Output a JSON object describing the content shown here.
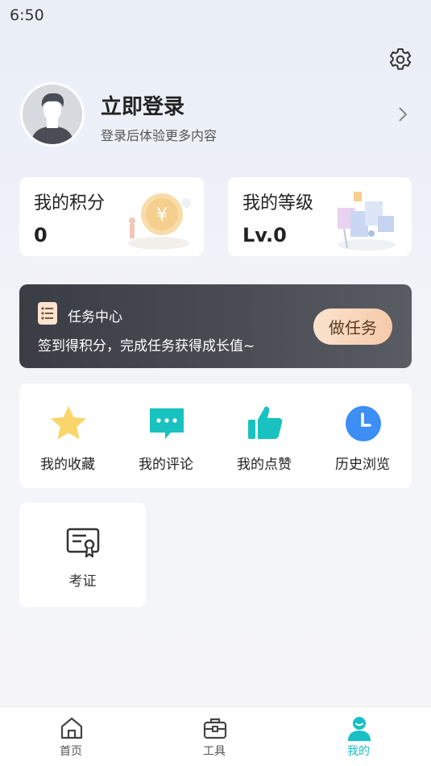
{
  "status_bar": {
    "time": "6:50"
  },
  "profile": {
    "login_title": "立即登录",
    "login_subtitle": "登录后体验更多内容"
  },
  "stats": {
    "points_label": "我的积分",
    "points_value": "0",
    "level_label": "我的等级",
    "level_value": "Lv.0"
  },
  "task_center": {
    "title": "任务中心",
    "description": "签到得积分，完成任务获得成长值~",
    "button_label": "做任务"
  },
  "quick_actions": [
    {
      "label": "我的收藏",
      "icon": "star-icon",
      "color": "#f9d56b"
    },
    {
      "label": "我的评论",
      "icon": "comment-icon",
      "color": "#19c2bf"
    },
    {
      "label": "我的点赞",
      "icon": "thumbs-up-icon",
      "color": "#19c2bf"
    },
    {
      "label": "历史浏览",
      "icon": "clock-icon",
      "color": "#3d8ef5"
    }
  ],
  "tools": [
    {
      "label": "考证",
      "icon": "certificate-icon"
    }
  ],
  "bottom_nav": [
    {
      "label": "首页",
      "icon": "home-icon",
      "active": false
    },
    {
      "label": "工具",
      "icon": "toolbox-icon",
      "active": false
    },
    {
      "label": "我的",
      "icon": "user-icon",
      "active": true
    }
  ],
  "colors": {
    "accent": "#17bfc7",
    "task_button": "#f6caa8",
    "task_card": "#45474e"
  }
}
